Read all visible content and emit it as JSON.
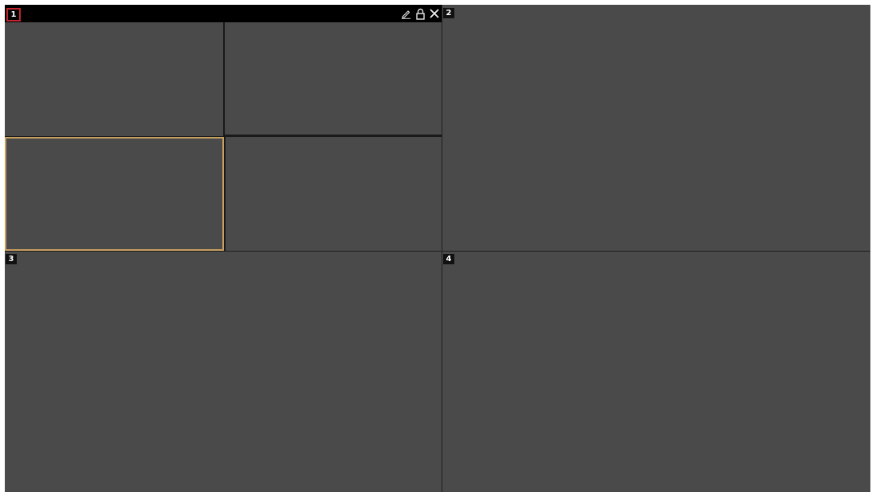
{
  "layout": {
    "panes": [
      {
        "number": "1",
        "selected": true
      },
      {
        "number": "2"
      },
      {
        "number": "3"
      },
      {
        "number": "4"
      }
    ],
    "pane1_tools": [
      {
        "icon": "edit-icon"
      },
      {
        "icon": "lock-icon"
      },
      {
        "icon": "close-icon"
      }
    ]
  },
  "colors": {
    "pane_background": "#4a4a4a",
    "grid_lines": "#1e1e1e",
    "header": "#000000",
    "selected_number_border": "#c0262c",
    "selected_cell_border": "#c8a060"
  }
}
